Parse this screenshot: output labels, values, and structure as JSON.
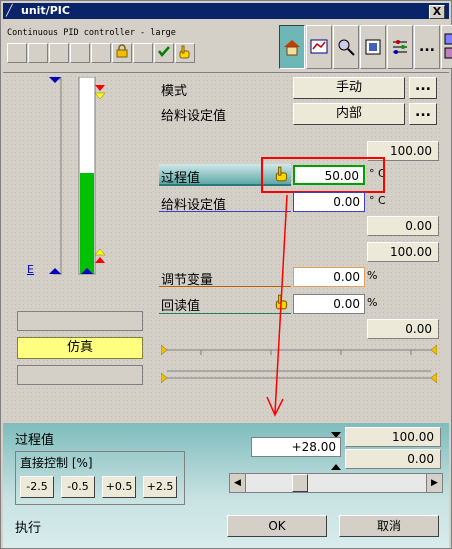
{
  "window": {
    "title": "unit/PIC",
    "close_label": "X"
  },
  "faceplate": {
    "subtitle": "Continuous PID controller - large"
  },
  "toolbar_icons": [
    "home-icon",
    "trend-icon",
    "magnify-icon",
    "parameter-icon",
    "loop-icon",
    "more-icon",
    "batch-icon"
  ],
  "rows": {
    "mode_label": "模式",
    "mode_value": "手动",
    "sp_source_label": "给料设定值",
    "sp_source_value": "内部",
    "dots": "...",
    "pv_high": "100.00",
    "pv_label": "过程值",
    "pv_value": "50.00",
    "pv_unit": "° C",
    "sp_label": "给料设定值",
    "sp_value": "0.00",
    "sp_unit": "° C",
    "sp_low": "0.00",
    "out_high": "100.00",
    "mv_label": "调节变量",
    "mv_value": "0.00",
    "mv_unit": "%",
    "rb_label": "回读值",
    "rb_value": "0.00",
    "rb_unit": "%",
    "out_low": "0.00"
  },
  "scale_label": "E",
  "left_buttons": {
    "simulate": "仿真"
  },
  "bottom": {
    "title": "过程值",
    "group_label": "直接控制 [%]",
    "step_buttons": [
      "-2.5",
      "-0.5",
      "+0.5",
      "+2.5"
    ],
    "input_value": "+28.00",
    "max_value": "100.00",
    "min_value": "0.00",
    "slider_fraction": 0.28,
    "execute_label": "执行",
    "ok_label": "OK",
    "cancel_label": "取消"
  }
}
